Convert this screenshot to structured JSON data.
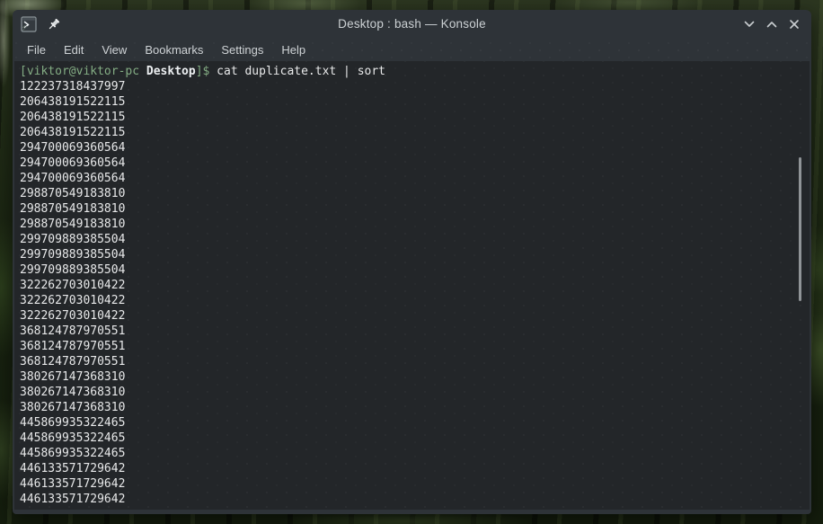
{
  "window": {
    "title": "Desktop : bash — Konsole",
    "icons": {
      "app": "konsole-terminal-icon",
      "pin": "pin-icon",
      "minimize": "chevron-down-icon",
      "maximize": "chevron-up-icon",
      "close": "close-x-icon"
    }
  },
  "menubar": {
    "items": [
      "File",
      "Edit",
      "View",
      "Bookmarks",
      "Settings",
      "Help"
    ]
  },
  "terminal": {
    "prompt": {
      "user_host": "[viktor@viktor-pc",
      "cwd": " Desktop",
      "suffix": "]$ ",
      "command": "cat duplicate.txt | sort"
    },
    "output_lines": [
      "122237318437997",
      "206438191522115",
      "206438191522115",
      "206438191522115",
      "294700069360564",
      "294700069360564",
      "294700069360564",
      "298870549183810",
      "298870549183810",
      "298870549183810",
      "299709889385504",
      "299709889385504",
      "299709889385504",
      "322262703010422",
      "322262703010422",
      "322262703010422",
      "368124787970551",
      "368124787970551",
      "368124787970551",
      "380267147368310",
      "380267147368310",
      "380267147368310",
      "445869935322465",
      "445869935322465",
      "445869935322465",
      "446133571729642",
      "446133571729642",
      "446133571729642"
    ]
  },
  "colors": {
    "titlebar_bg": "#2e3338",
    "terminal_bg": "#232629",
    "terminal_fg": "#e8e9ea",
    "prompt_green": "#84ad84",
    "scrollbar": "#909497"
  }
}
